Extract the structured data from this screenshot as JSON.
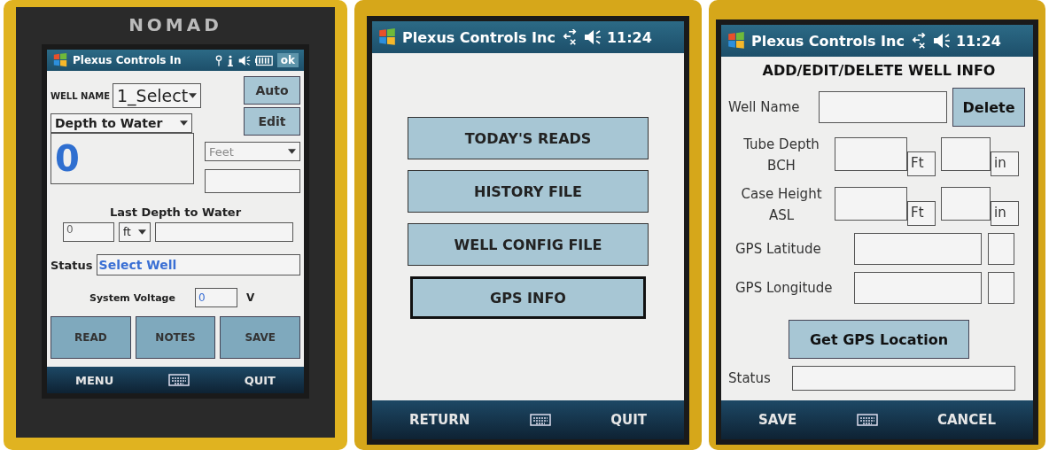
{
  "main_screen": {
    "brand": "NOMAD",
    "title": "Plexus Controls In",
    "ok": "ok",
    "well_name_label": "WELL NAME",
    "well_select": "1_Select",
    "auto_button": "Auto",
    "edit_button": "Edit",
    "measure_select": "Depth to Water",
    "reading": "0",
    "unit_select": "Feet",
    "last_label": "Last Depth to Water",
    "last_value": "0",
    "last_unit": "ft",
    "status_label": "Status",
    "status_value": "Select Well",
    "voltage_label": "System Voltage",
    "voltage_value": "0",
    "voltage_unit": "V",
    "buttons": [
      "READ",
      "NOTES",
      "SAVE"
    ],
    "softkeys": [
      "MENU",
      "QUIT"
    ]
  },
  "menu_screen": {
    "title": "Plexus Controls Inc",
    "clock": "11:24",
    "menu_buttons": [
      {
        "label": "TODAY'S READS",
        "selected": false
      },
      {
        "label": "HISTORY FILE",
        "selected": false
      },
      {
        "label": "WELL CONFIG FILE",
        "selected": false
      },
      {
        "label": "GPS INFO",
        "selected": true
      }
    ],
    "softkeys": [
      "RETURN",
      "QUIT"
    ]
  },
  "well_info_screen": {
    "title": "Plexus Controls Inc",
    "clock": "11:24",
    "heading": "ADD/EDIT/DELETE WELL INFO",
    "well_name_label": "Well Name",
    "delete_button": "Delete",
    "measurements": [
      {
        "label": "Tube Depth",
        "sublabel": "BCH",
        "unit_1": "Ft",
        "unit_2": "in"
      },
      {
        "label": "Case Height",
        "sublabel": "ASL",
        "unit_1": "Ft",
        "unit_2": "in"
      }
    ],
    "gps_rows": [
      {
        "label": "GPS Latitude"
      },
      {
        "label": "GPS Longitude"
      }
    ],
    "gps_button": "Get GPS Location",
    "status_label": "Status",
    "softkeys": [
      "SAVE",
      "CANCEL"
    ]
  }
}
